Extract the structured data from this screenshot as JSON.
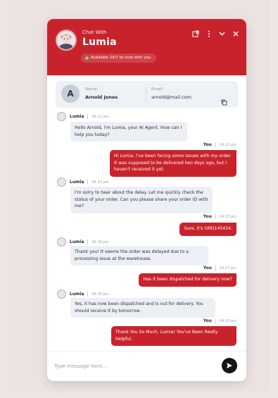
{
  "header": {
    "chat_with": "Chat With",
    "bot_name": "Lumia",
    "availability": "Available 24/7 to chat with you",
    "icons": [
      "open-external-icon",
      "more-vertical-icon",
      "chevron-down-icon",
      "close-icon"
    ],
    "color": "#c8232c"
  },
  "user_card": {
    "avatar_initial": "A",
    "name_label": "Name:",
    "name_value": "Arnold Jones",
    "email_label": "Email:",
    "email_value": "arnold@mail.com"
  },
  "messages": [
    {
      "sender": "agent",
      "name": "Lumia",
      "time": "04:11 pm",
      "text": "Hello Arnold, I'm Lumia, your AI Agent. How can I help you today?"
    },
    {
      "sender": "user",
      "name": "You",
      "time": "04:12 pm",
      "text": "Hi Lumia, I've been facing some issues with my order. It was supposed to be delivered two days ago, but I haven't received it yet."
    },
    {
      "sender": "agent",
      "name": "Lumia",
      "time": "04:13 pm",
      "text": "I'm sorry to hear about the delay. Let me quickly check the status of your order. Can you please share your order ID with me?"
    },
    {
      "sender": "user",
      "name": "You",
      "time": "04:15 pm",
      "text": "Sure, it's ORD145434."
    },
    {
      "sender": "agent",
      "name": "Lumia",
      "time": "04:16 pm",
      "text": "Thank you! It seems the order was delayed due to a processing issue at the warehouse."
    },
    {
      "sender": "user",
      "name": "You",
      "time": "04:17 pm",
      "text": "Has it been dispatched for delivery now?"
    },
    {
      "sender": "agent",
      "name": "Lumia",
      "time": "04:18 pm",
      "text": "Yes, it has now been dispatched and is out for delivery. You should receive it by tomorrow."
    },
    {
      "sender": "user",
      "name": "You",
      "time": "04:19 pm",
      "text": "Thank You So Much, Lumia! You've Been Really Helpful."
    }
  ],
  "composer": {
    "placeholder": "Type message here...",
    "send_icon": "send-arrow-icon"
  }
}
